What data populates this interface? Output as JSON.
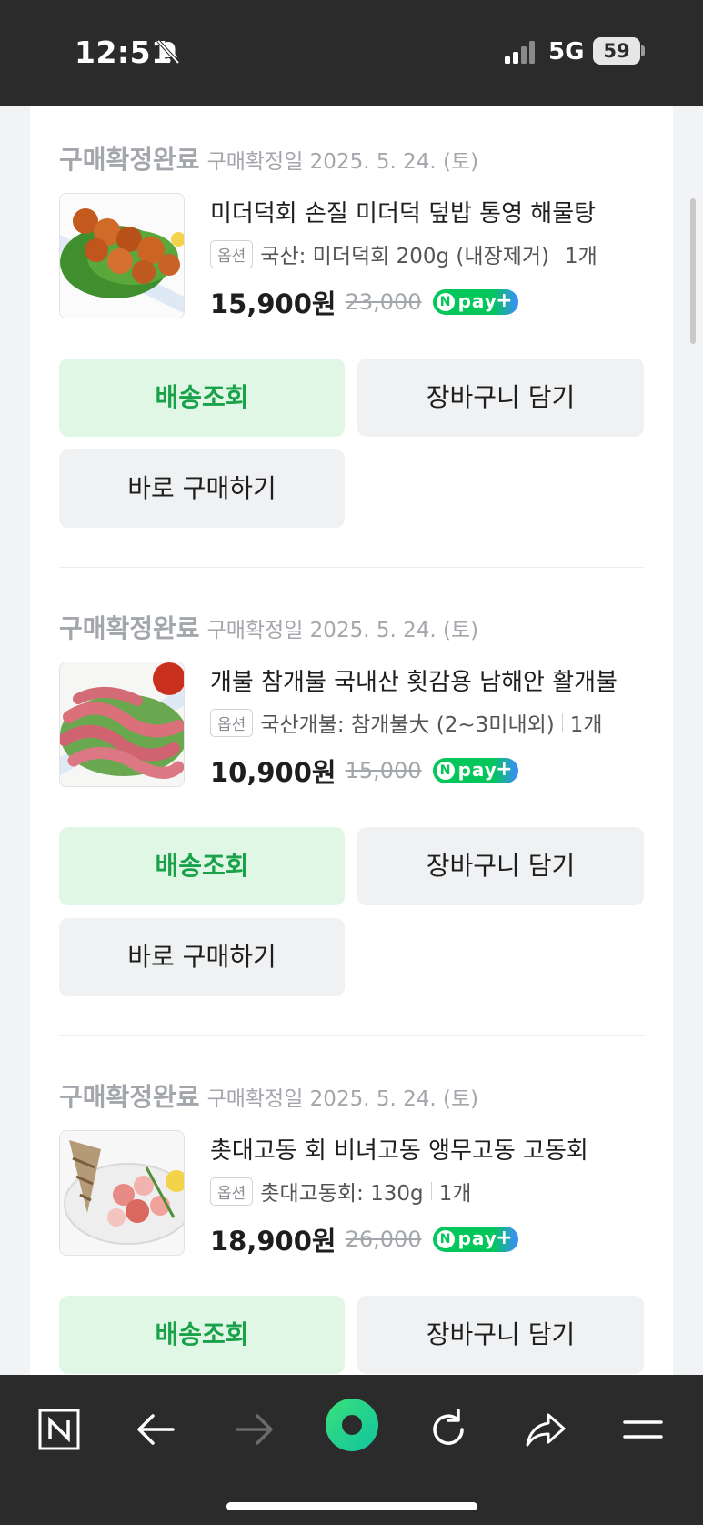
{
  "status_bar": {
    "time": "12:51",
    "network": "5G",
    "battery": "59"
  },
  "orders": [
    {
      "status": "구매확정완료",
      "date": "구매확정일 2025. 5. 24. (토)",
      "name": "미더덕회 손질 미더덕 덮밥 통영 해물탕",
      "option_badge": "옵션",
      "option": "국산: 미더덕회 200g (내장제거)",
      "qty": "1개",
      "price": "15,900원",
      "original_price": "23,000",
      "buttons": {
        "track": "배송조회",
        "cart": "장바구니 담기",
        "buy": "바로 구매하기"
      }
    },
    {
      "status": "구매확정완료",
      "date": "구매확정일 2025. 5. 24. (토)",
      "name": "개불 참개불 국내산 횟감용 남해안 활개불",
      "option_badge": "옵션",
      "option": "국산개불: 참개불大 (2~3미내외)",
      "qty": "1개",
      "price": "10,900원",
      "original_price": "15,000",
      "buttons": {
        "track": "배송조회",
        "cart": "장바구니 담기",
        "buy": "바로 구매하기"
      }
    },
    {
      "status": "구매확정완료",
      "date": "구매확정일 2025. 5. 24. (토)",
      "name": "촛대고동 회 비녀고동 앵무고동 고동회",
      "option_badge": "옵션",
      "option": "촛대고동회: 130g",
      "qty": "1개",
      "price": "18,900원",
      "original_price": "26,000",
      "buttons": {
        "track": "배송조회",
        "cart": "장바구니 담기"
      }
    }
  ],
  "npay_label": {
    "letter": "N",
    "text": "pay",
    "plus": "+"
  },
  "colors": {
    "accent_green": "#19a24a",
    "track_button_bg": "#e1f7e6",
    "dark_bar": "#2b2b2b"
  }
}
